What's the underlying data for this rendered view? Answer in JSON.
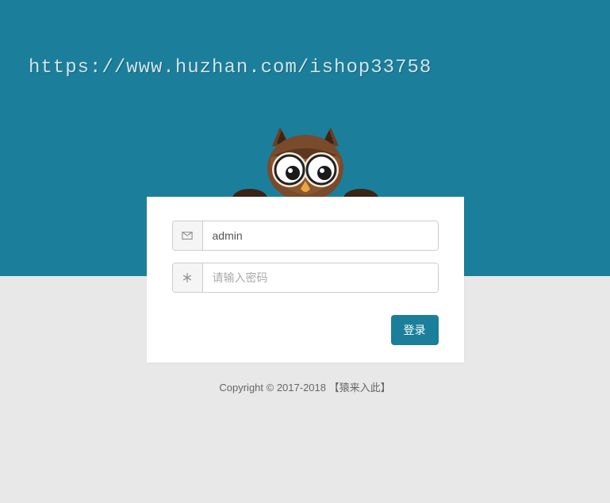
{
  "watermark": "https://www.huzhan.com/ishop33758",
  "form": {
    "username_value": "admin",
    "username_placeholder": "",
    "password_value": "",
    "password_placeholder": "请输入密码",
    "submit_label": "登录"
  },
  "footer": "Copyright © 2017-2018 【猿来入此】",
  "colors": {
    "brand": "#1b7f9b"
  }
}
